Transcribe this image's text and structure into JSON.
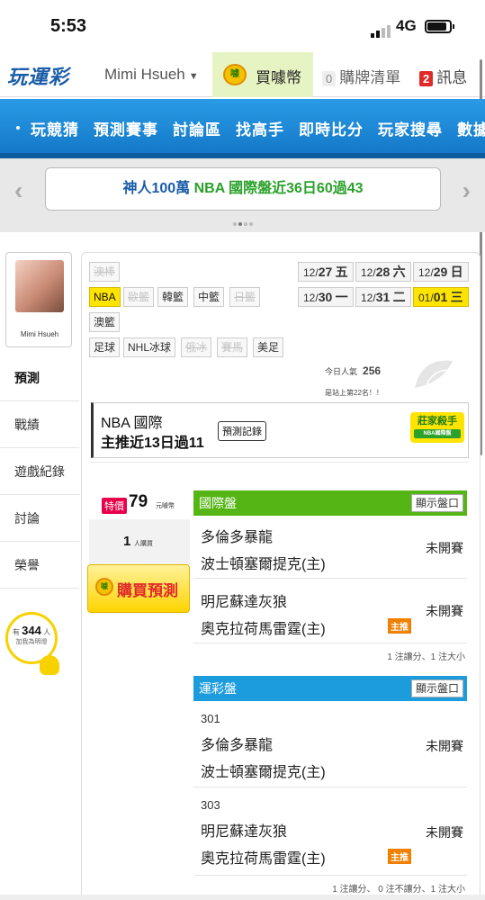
{
  "status_bar": {
    "time": "5:53",
    "network": "4G"
  },
  "top_nav": {
    "logo": "玩運彩",
    "user_name": "Mimi Hsueh",
    "buy_coin_label": "買噱幣",
    "coin_icon_text": "噱",
    "cart_count": "0",
    "cart_label": "購牌清單",
    "message_count": "2",
    "message_label": "訊息"
  },
  "main_menu": [
    "玩競猜",
    "預測賽事",
    "討論區",
    "找高手",
    "即時比分",
    "玩家搜尋",
    "數據"
  ],
  "banner": {
    "text_part1": "神人100萬",
    "text_part2": "NBA 國際盤近36日60過43"
  },
  "profile": {
    "name": "Mimi Hsueh"
  },
  "side_tabs": [
    "預測",
    "戰績",
    "遊戲紀錄",
    "討論",
    "榮譽"
  ],
  "fans": {
    "prefix": "有",
    "count": "344",
    "unit": "人",
    "label": "加我為明燈"
  },
  "sports": {
    "row1": [
      "澳棒"
    ],
    "row2": [
      "NBA",
      "歐籃",
      "韓籃",
      "中籃",
      "日籃"
    ],
    "row3": [
      "澳籃"
    ],
    "row4": [
      "足球",
      "NHL冰球",
      "俄冰",
      "賽馬",
      "美足"
    ]
  },
  "dates": {
    "row1": [
      {
        "md": "12/",
        "d": "27",
        "w": "五"
      },
      {
        "md": "12/",
        "d": "28",
        "w": "六"
      },
      {
        "md": "12/",
        "d": "29",
        "w": "日"
      }
    ],
    "row2": [
      {
        "md": "12/",
        "d": "30",
        "w": "一"
      },
      {
        "md": "12/",
        "d": "31",
        "w": "二"
      },
      {
        "md": "01/",
        "d": "01",
        "w": "三"
      }
    ]
  },
  "popularity": {
    "label": "今日人氣",
    "value": "256",
    "rank_text": "是站上第22名！！"
  },
  "record": {
    "league": "NBA 國際",
    "summary": "主推近13日過11",
    "button": "預測記錄",
    "brand_title": "莊家殺手",
    "brand_sub": "NBA國際盤"
  },
  "purchase": {
    "special_tag": "特價",
    "price": "79",
    "price_unit": "元噱幣",
    "buyers": "1",
    "buyers_unit": "人購買",
    "buy_button": "購買預測",
    "coin_icon_text": "噱"
  },
  "panels": [
    {
      "title": "國際盤",
      "toggle": "顯示盤口",
      "games": [
        {
          "code": "",
          "away": "多倫多暴龍",
          "home": "波士頓塞爾提克(主)",
          "status": "未開賽",
          "main_pick": ""
        },
        {
          "code": "",
          "away": "明尼蘇達灰狼",
          "home": "奧克拉荷馬雷霆(主)",
          "status": "未開賽",
          "main_pick": "主推"
        }
      ],
      "footer": "1 注讓分、1 注大小"
    },
    {
      "title": "運彩盤",
      "toggle": "顯示盤口",
      "games": [
        {
          "code": "301",
          "away": "多倫多暴龍",
          "home": "波士頓塞爾提克(主)",
          "status": "未開賽",
          "main_pick": ""
        },
        {
          "code": "303",
          "away": "明尼蘇達灰狼",
          "home": "奧克拉荷馬雷霆(主)",
          "status": "未開賽",
          "main_pick": "主推"
        }
      ],
      "footer": "1 注讓分、 0 注不讓分、1 注大小"
    }
  ],
  "colors": {
    "brand_blue": "#1a5ca8",
    "menu_blue": "#1c8ad8",
    "panel_green": "#55b514",
    "panel_blue": "#1c9cdc",
    "highlight_yellow": "#ffe400",
    "main_pick_orange": "#f08000"
  }
}
